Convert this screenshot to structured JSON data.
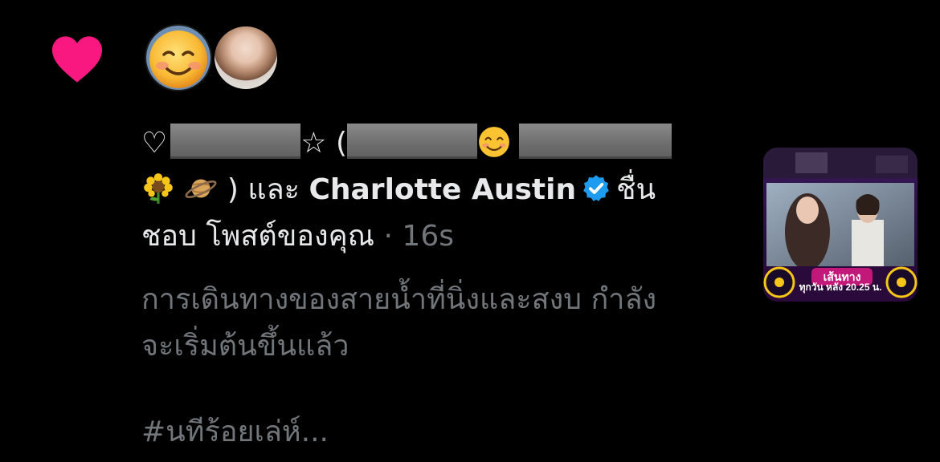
{
  "notification": {
    "icon": "heart-icon",
    "accent_color": "#f91880",
    "avatars": [
      "smiling-face-emoji-avatar",
      "profile-photo-avatar"
    ],
    "lead_symbol": "♡",
    "star_symbol": "☆",
    "open_paren": "(",
    "close_paren": ")",
    "conjunction": "และ",
    "liker_name": "Charlotte Austin",
    "verified_color": "#1d9bf0",
    "action_text_1": "ชื่น",
    "action_text_2": "ชอบ โพสต์ของคุณ",
    "separator": "·",
    "timestamp": "16s"
  },
  "post": {
    "line1": "การเดินทางของสายน้ำที่นิ่งและสงบ กำลัง",
    "line2": "จะเริ่มต้นขึ้นแล้ว",
    "hashtag": "#นทีร้อยเล่ห์..."
  },
  "thumbnail": {
    "logo_text": "เส้นทาง",
    "caption": "ทุกวัน หลัง 20.25 น."
  }
}
